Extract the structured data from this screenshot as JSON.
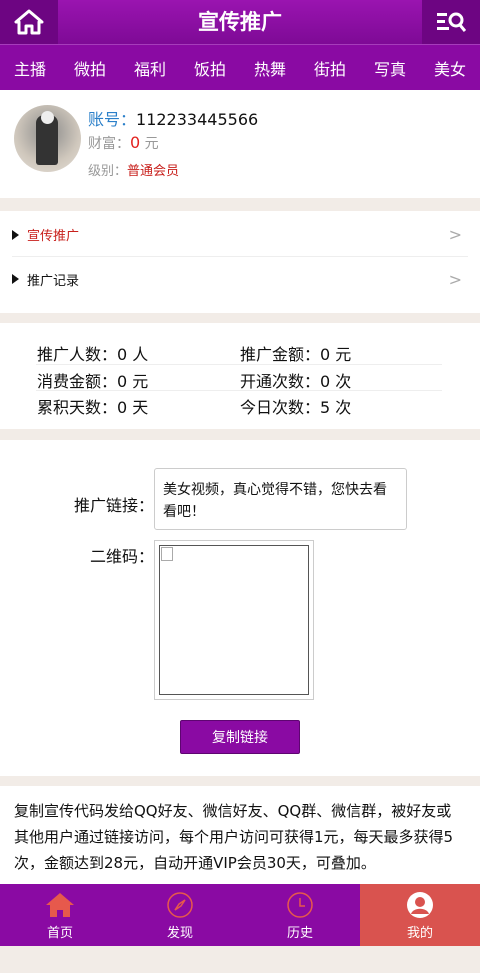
{
  "header": {
    "title": "宣传推广",
    "home_icon": "home-icon",
    "search_icon": "menu-search-icon"
  },
  "nav": {
    "items": [
      "主播",
      "微拍",
      "福利",
      "饭拍",
      "热舞",
      "街拍",
      "写真",
      "美女"
    ]
  },
  "profile": {
    "account_label": "账号：",
    "account_value": "112233445566",
    "wealth_label": "财富：",
    "wealth_value": "0",
    "wealth_unit": "元",
    "level_label": "级别：",
    "level_value": "普通会员"
  },
  "menu": {
    "items": [
      {
        "label": "宣传推广",
        "arrow": ">"
      },
      {
        "label": "推广记录",
        "arrow": ">"
      }
    ]
  },
  "stats": {
    "promo_count": "推广人数：0 人",
    "promo_amount": "推广金额：0 元",
    "spend_amount": "消费金额：0 元",
    "activations": "开通次数：0 次",
    "total_days": "累积天数：0 天",
    "today_count": "今日次数：5 次"
  },
  "promo": {
    "link_label": "推广链接：",
    "link_text": "美女视频，真心觉得不错，您快去看看吧！",
    "qr_label": "二维码：",
    "copy_button": "复制链接"
  },
  "description": "复制宣传代码发给QQ好友、微信好友、QQ群、微信群，被好友或其他用户通过链接访问，每个用户访问可获得1元，每天最多获得5次，金额达到28元，自动开通VIP会员30天，可叠加。",
  "tabbar": {
    "items": [
      {
        "label": "首页",
        "icon": "home-icon"
      },
      {
        "label": "发现",
        "icon": "compass-icon"
      },
      {
        "label": "历史",
        "icon": "clock-icon"
      },
      {
        "label": "我的",
        "icon": "user-icon"
      }
    ]
  },
  "colors": {
    "brand_purple": "#8a0aa3",
    "accent_red": "#d9534f",
    "link_blue": "#2a7fc9"
  }
}
